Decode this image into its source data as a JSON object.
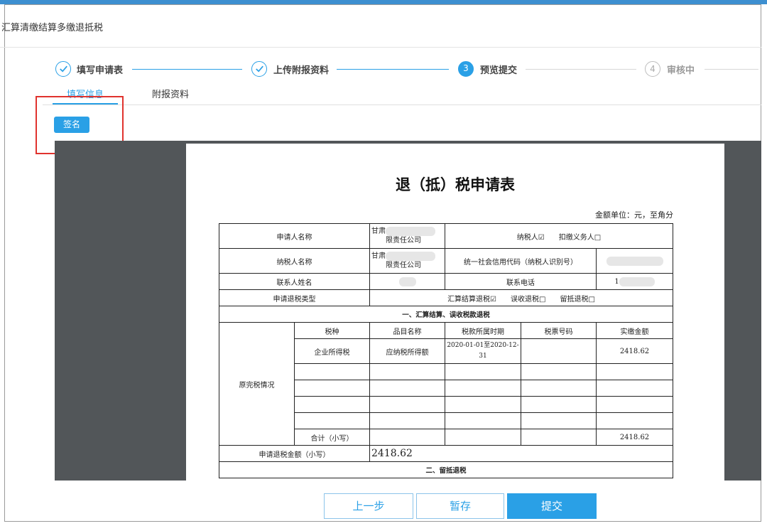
{
  "page": {
    "title": "汇算清缴结算多缴退抵税"
  },
  "steps": [
    {
      "label": "填写申请表",
      "number": "",
      "state": "done"
    },
    {
      "label": "上传附报资料",
      "number": "",
      "state": "done"
    },
    {
      "label": "预览提交",
      "number": "3",
      "state": "active"
    },
    {
      "label": "审核中",
      "number": "4",
      "state": "todo"
    }
  ],
  "tabs": [
    {
      "label": "填写信息",
      "active": true
    },
    {
      "label": "附报资料",
      "active": false
    }
  ],
  "toolbar": {
    "sign_label": "签名"
  },
  "document": {
    "title": "退（抵）税申请表",
    "unit_note": "金额单位：元，至角分",
    "rows": {
      "applicant_name_label": "申请人名称",
      "applicant_name_value_1": "甘肃",
      "applicant_name_value_2": "限责任公司",
      "taxpayer_flags": "纳税人☑　　扣缴义务人□",
      "taxpayer_name_label": "纳税人名称",
      "taxpayer_name_value_1": "甘肃",
      "taxpayer_name_value_2": "限责任公司",
      "credit_code_label": "统一社会信用代码（纳税人识别号）",
      "contact_label": "联系人姓名",
      "phone_label": "联系电话",
      "phone_value": "1",
      "refund_type_label": "申请退税类型",
      "refund_type_value": "汇算结算退税☑　　误收退税□　　留抵退税□",
      "section1_title": "一、汇算结算、误收税款退税",
      "original_tax_label": "原完税情况",
      "headers": [
        "税种",
        "品目名称",
        "税款所属时期",
        "税票号码",
        "实缴金额"
      ],
      "detail_row": {
        "tax_type": "企业所得税",
        "item": "应纳税所得额",
        "period": "2020-01-01至2020-12-31",
        "ticket": "",
        "amount": "2418.62"
      },
      "subtotal_label": "合计（小写）",
      "subtotal_amount": "2418.62",
      "refund_amount_label": "申请退税金额（小写）",
      "refund_amount_value": "2418.62",
      "section2_title": "二、留抵退税"
    }
  },
  "buttons": {
    "prev": "上一步",
    "save": "暂存",
    "submit": "提交"
  },
  "colors": {
    "accent": "#2aa0e6",
    "highlight": "#e0332e",
    "viewer_bg": "#525659"
  }
}
